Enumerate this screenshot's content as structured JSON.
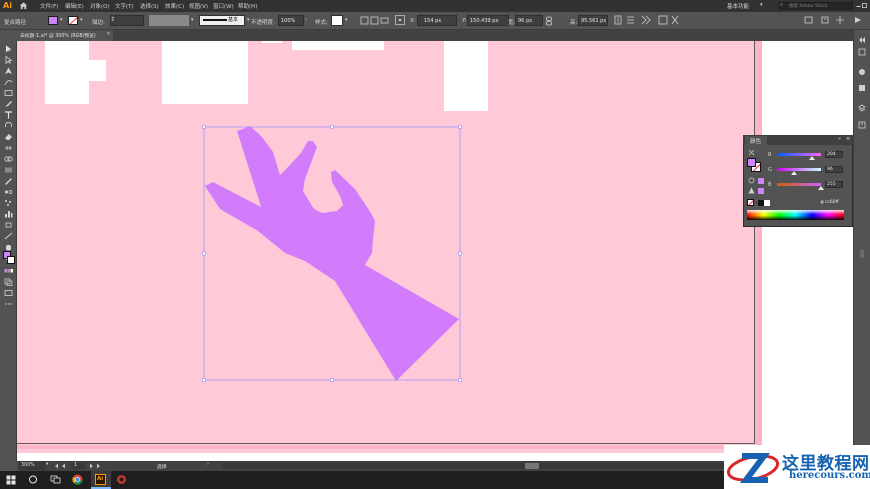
{
  "app": {
    "logo": "Ai",
    "menu": [
      "文件(F)",
      "编辑(E)",
      "对象(O)",
      "文字(T)",
      "选择(S)",
      "效果(C)",
      "视图(V)",
      "窗口(W)",
      "帮助(H)"
    ],
    "workspace": "基本功能",
    "search_placeholder": "搜索 Adobe Stock"
  },
  "control_bar": {
    "object_type": "复合路径",
    "fill_color": "#d084f9",
    "stroke_label": "描边:",
    "brush_label": "基本",
    "opacity_label": "不透明度:",
    "opacity_value": "100%",
    "style_label": "样式:",
    "x_label": "X:",
    "x_value": "154 px",
    "y_label": "Y:",
    "y_value": "150.439 px",
    "w_label": "宽:",
    "w_value": "96 px",
    "h_label": "高:",
    "h_value": "95.561 px"
  },
  "document": {
    "tab_title": "未标题-1.ai* @ 300% (RGB/预览)"
  },
  "canvas": {
    "artboard_color": "#ffc9d8",
    "shape_color": "#d27bfb",
    "selection_color": "#8f8fff"
  },
  "color_panel": {
    "title": "颜色",
    "channels": [
      {
        "label": "R",
        "value": "204",
        "fraction": 0.8
      },
      {
        "label": "G",
        "value": "96",
        "fraction": 0.376
      },
      {
        "label": "B",
        "value": "255",
        "fraction": 1.0
      }
    ],
    "hex_prefix": "#",
    "hex_value": "cc60ff"
  },
  "status_bar": {
    "zoom": "300%",
    "page": "1",
    "mode": "选择"
  },
  "watermark": {
    "name_cn": "这里教程网",
    "url": "herecours.com"
  }
}
